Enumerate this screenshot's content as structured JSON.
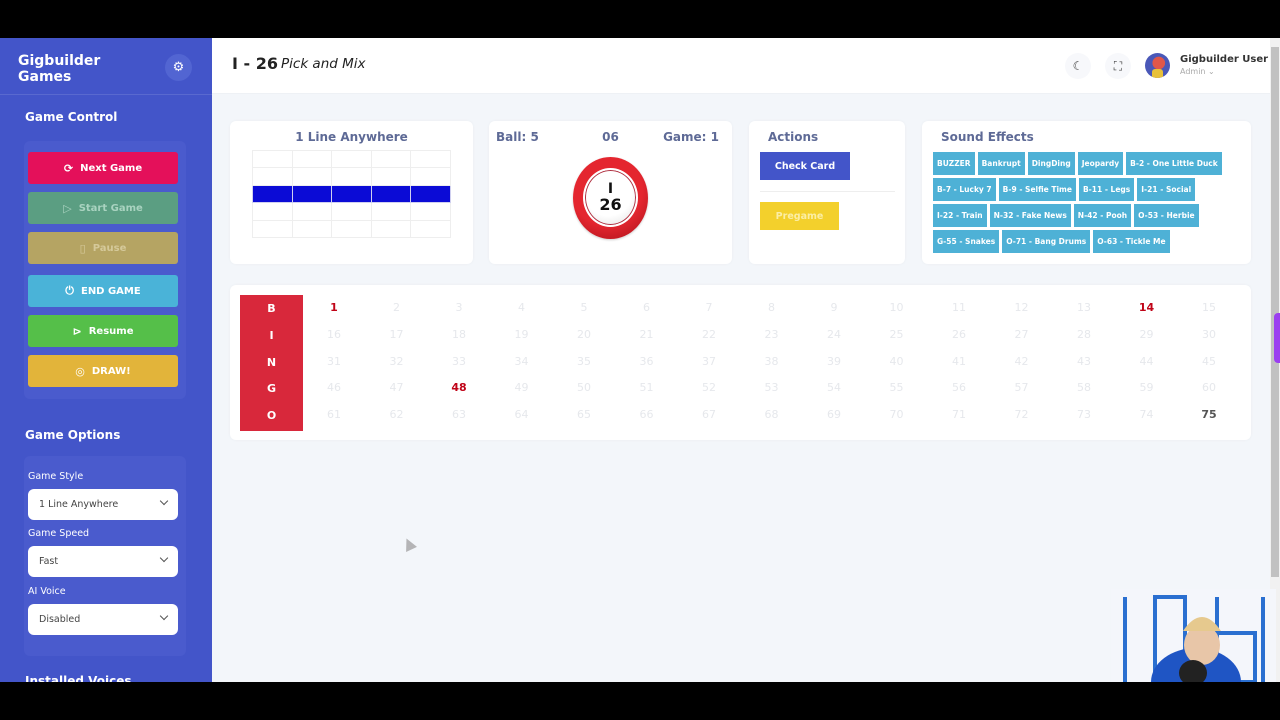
{
  "sidebar": {
    "brand": "Gigbuilder Games",
    "settings_icon": "gear-icon",
    "game_control_title": "Game Control",
    "buttons": [
      {
        "label": "Next Game",
        "icon": "refresh-icon",
        "color": "#e4105a"
      },
      {
        "label": "Start Game",
        "icon": "play-outline-icon",
        "color": "#5b9e82"
      },
      {
        "label": "Pause",
        "icon": "pause-icon",
        "color": "#b5a463"
      },
      {
        "label": "END GAME",
        "icon": "power-icon",
        "color": "#4ab3d8"
      },
      {
        "label": "Resume",
        "icon": "play-circle-icon",
        "color": "#55bf49"
      },
      {
        "label": "DRAW!",
        "icon": "target-icon",
        "color": "#e2b43a"
      }
    ],
    "game_options_title": "Game Options",
    "options": [
      {
        "label": "Game Style",
        "value": "1 Line Anywhere"
      },
      {
        "label": "Game Speed",
        "value": "Fast"
      },
      {
        "label": "AI Voice",
        "value": "Disabled"
      }
    ],
    "installed_voices_title": "Installed Voices"
  },
  "header": {
    "current_call": "I - 26",
    "call_name": "Pick and Mix",
    "dark_mode_icon": "moon-icon",
    "fullscreen_icon": "fullscreen-icon",
    "user_name": "Gigbuilder User",
    "user_role": "Admin ⌄"
  },
  "pattern_card": {
    "title": "1 Line Anywhere",
    "rows": [
      [
        0,
        0,
        0,
        0,
        0
      ],
      [
        0,
        0,
        0,
        0,
        0
      ],
      [
        1,
        1,
        1,
        1,
        1
      ],
      [
        0,
        0,
        0,
        0,
        0
      ],
      [
        0,
        0,
        0,
        0,
        0
      ]
    ]
  },
  "ball_card": {
    "ball_count": "Ball: 5",
    "center_value": "06",
    "game_count": "Game: 1",
    "ball_letter": "I",
    "ball_number": "26"
  },
  "actions_card": {
    "title": "Actions",
    "check_card": "Check Card",
    "pregame": "Pregame"
  },
  "sound_effects": {
    "title": "Sound Effects",
    "items": [
      "BUZZER",
      "Bankrupt",
      "DingDing",
      "Jeopardy",
      "B-2 - One Little Duck",
      "B-7 - Lucky 7",
      "B-9 - Selfie Time",
      "B-11 - Legs",
      "I-21 - Social",
      "I-22 - Train",
      "N-32 - Fake News",
      "N-42 - Pooh",
      "O-53 - Herbie",
      "G-55 - Snakes",
      "O-71 - Bang Drums",
      "O-63 - Tickle Me"
    ]
  },
  "board": {
    "letters": [
      "B",
      "I",
      "N",
      "G",
      "O"
    ],
    "called": [
      1,
      14,
      48
    ],
    "last_called": [
      75
    ]
  }
}
